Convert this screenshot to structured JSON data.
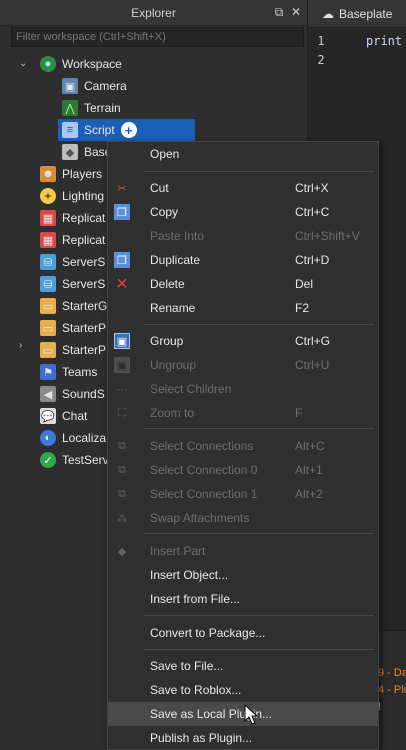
{
  "explorer": {
    "title": "Explorer",
    "filter_placeholder": "Filter workspace (Ctrl+Shift+X)",
    "tree": [
      {
        "label": "Workspace"
      },
      {
        "label": "Camera"
      },
      {
        "label": "Terrain"
      },
      {
        "label": "Script"
      },
      {
        "label": "Base"
      },
      {
        "label": "Players"
      },
      {
        "label": "Lighting"
      },
      {
        "label": "Replicat"
      },
      {
        "label": "Replicat"
      },
      {
        "label": "ServerS"
      },
      {
        "label": "ServerS"
      },
      {
        "label": "StarterG"
      },
      {
        "label": "StarterP"
      },
      {
        "label": "StarterP"
      },
      {
        "label": "Teams"
      },
      {
        "label": "SoundS"
      },
      {
        "label": "Chat"
      },
      {
        "label": "Localiza"
      },
      {
        "label": "TestServ"
      }
    ]
  },
  "editor": {
    "tab_label": "Baseplate",
    "line_numbers": [
      "1",
      "2"
    ],
    "code_line_1": "print",
    "output_lines": [
      "9 - Da",
      "4 - Plu",
      "!"
    ]
  },
  "context_menu": {
    "items": [
      {
        "label": "Open",
        "shortcut": ""
      },
      {
        "label": "Cut",
        "shortcut": "Ctrl+X"
      },
      {
        "label": "Copy",
        "shortcut": "Ctrl+C"
      },
      {
        "label": "Paste Into",
        "shortcut": "Ctrl+Shift+V"
      },
      {
        "label": "Duplicate",
        "shortcut": "Ctrl+D"
      },
      {
        "label": "Delete",
        "shortcut": "Del"
      },
      {
        "label": "Rename",
        "shortcut": "F2"
      },
      {
        "label": "Group",
        "shortcut": "Ctrl+G"
      },
      {
        "label": "Ungroup",
        "shortcut": "Ctrl+U"
      },
      {
        "label": "Select Children",
        "shortcut": ""
      },
      {
        "label": "Zoom to",
        "shortcut": "F"
      },
      {
        "label": "Select Connections",
        "shortcut": "Alt+C"
      },
      {
        "label": "Select Connection 0",
        "shortcut": "Alt+1"
      },
      {
        "label": "Select Connection 1",
        "shortcut": "Alt+2"
      },
      {
        "label": "Swap Attachments",
        "shortcut": ""
      },
      {
        "label": "Insert Part",
        "shortcut": ""
      },
      {
        "label": "Insert Object...",
        "shortcut": ""
      },
      {
        "label": "Insert from File...",
        "shortcut": ""
      },
      {
        "label": "Convert to Package...",
        "shortcut": ""
      },
      {
        "label": "Save to File...",
        "shortcut": ""
      },
      {
        "label": "Save to Roblox...",
        "shortcut": ""
      },
      {
        "label": "Save as Local Plugin...",
        "shortcut": ""
      },
      {
        "label": "Publish as Plugin...",
        "shortcut": ""
      }
    ]
  },
  "colors": {
    "selection": "#1c5fb8",
    "menu_hover": "#4a4a4a",
    "disabled_text": "#6e6e6e"
  }
}
